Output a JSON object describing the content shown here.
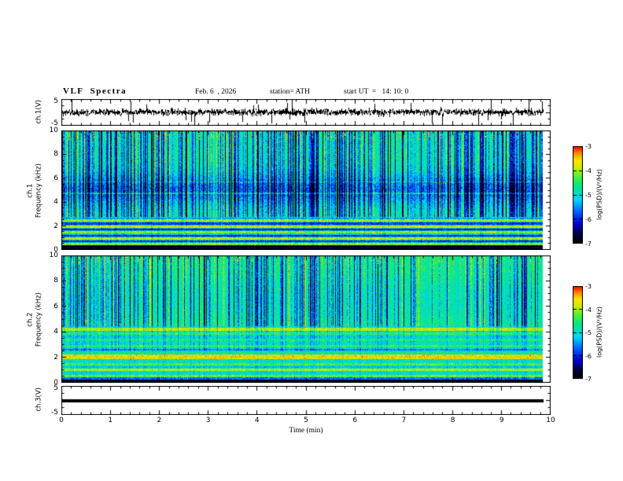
{
  "header": {
    "title": "VLF  Spectra",
    "date": "Feb. 6  , 2026",
    "station": "station= ATH",
    "start_ut": "start UT  =   14: 10: 0"
  },
  "axes": {
    "xlabel": "Time (min)",
    "xticks": [
      "0",
      "1",
      "2",
      "3",
      "4",
      "5",
      "6",
      "7",
      "8",
      "9",
      "10"
    ],
    "x_range_min": [
      0,
      10
    ]
  },
  "panels": {
    "wave1": {
      "ylabel": "ch.1(V)",
      "yticks": [
        "5",
        "-5"
      ],
      "y_range": [
        -5,
        5
      ]
    },
    "spec1": {
      "ylabel_line1": "ch.1",
      "ylabel_line2": "Frequency (kHz)",
      "yticks": [
        "10",
        "8",
        "6",
        "4",
        "2",
        "0"
      ],
      "y_range_khz": [
        0,
        10
      ]
    },
    "spec2": {
      "ylabel_line1": "ch.2",
      "ylabel_line2": "Frequency (kHz)",
      "yticks": [
        "10",
        "8",
        "6",
        "4",
        "2",
        "0"
      ],
      "y_range_khz": [
        0,
        10
      ]
    },
    "wave3": {
      "ylabel": "ch.3(V)",
      "yticks": [
        "5",
        "-5"
      ],
      "y_range": [
        -5,
        5
      ]
    }
  },
  "colorbar": {
    "label": "log(PSD)/(V²/Hz)",
    "ticks": [
      "-3",
      "-4",
      "-5",
      "-6",
      "-7"
    ],
    "range": [
      -7,
      -3
    ],
    "stops": [
      [
        0,
        "#000000"
      ],
      [
        0.1,
        "#00004a"
      ],
      [
        0.2,
        "#0000d2"
      ],
      [
        0.33,
        "#0064ff"
      ],
      [
        0.45,
        "#00d8ff"
      ],
      [
        0.58,
        "#00e690"
      ],
      [
        0.68,
        "#46f03c"
      ],
      [
        0.78,
        "#c8f000"
      ],
      [
        0.86,
        "#ffe400"
      ],
      [
        0.93,
        "#ff8c00"
      ],
      [
        1,
        "#ff0000"
      ]
    ]
  },
  "chart_data": [
    {
      "type": "line",
      "panel": "ch.1 waveform",
      "ylabel": "ch.1(V)",
      "ylim": [
        -5,
        5
      ],
      "xlim": [
        0,
        10
      ],
      "xlabel": "Time (min)",
      "description": "Dense broadband noise of roughly ±1.5 V about 0 V with frequent impulsive spikes reaching toward ±5 V across the full 10-minute record."
    },
    {
      "type": "heatmap",
      "panel": "ch.1 spectrogram",
      "ylabel": "ch.1 Frequency (kHz)",
      "ylim": [
        0,
        10
      ],
      "xlim": [
        0,
        10
      ],
      "zlabel": "log(PSD)/(V²/Hz)",
      "zlim": [
        -7,
        -3
      ],
      "description": "Green/cyan background near -5 with dense dark-blue vertical sferic streaks above ~3 kHz, a darker blue band around 4-6 kHz, scattered yellow and orange vertical streaks, thin lighter horizontal lines near 4.8 and 5.7 kHz, bright yellow-green and black horizontal harmonic stripes below ~2.6 kHz, and a black band near 0-0.4 kHz."
    },
    {
      "type": "heatmap",
      "panel": "ch.2 spectrogram",
      "ylabel": "ch.2 Frequency (kHz)",
      "ylim": [
        0,
        10
      ],
      "xlim": [
        0,
        10
      ],
      "zlabel": "log(PSD)/(V²/Hz)",
      "zlim": [
        -7,
        -3
      ],
      "description": "Brighter green background with dark-blue vertical sferic streaks above ~4 kHz, a strong yellow-orange horizontal band near 2 kHz and another near 4.2 kHz, a yellow line near 1 kHz, many fine yellow-green and dark horizontal lines below 4 kHz, and a black band near 0-0.2 kHz."
    },
    {
      "type": "line",
      "panel": "ch.3 waveform",
      "ylabel": "ch.3(V)",
      "ylim": [
        -5,
        5
      ],
      "xlim": [
        0,
        10
      ],
      "description": "Flat thick black trace at approximately 0 V for the entire record (no signal)."
    }
  ]
}
